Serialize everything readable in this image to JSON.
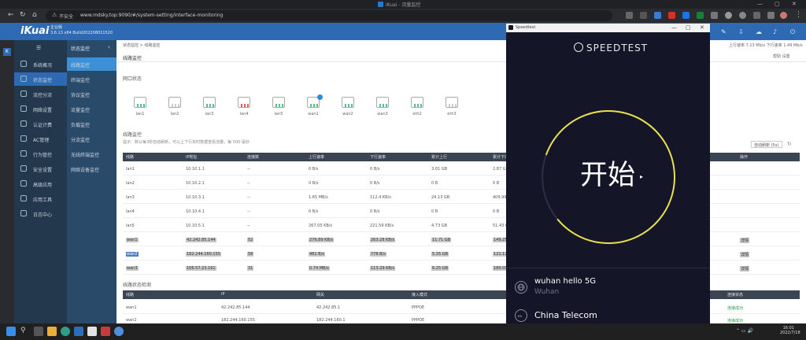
{
  "browser": {
    "title": "iKuai - 流量监控",
    "address_security": "不安全",
    "url": "www.mdsky.top:9090/#/system-setting/interface-monitoring"
  },
  "app": {
    "logo": "iKuai",
    "device_name": "企业版",
    "version": "3.6.13 x64 Build202208011520",
    "menu_label": "状态监控"
  },
  "sidebar": {
    "items": [
      {
        "label": "系统概况"
      },
      {
        "label": "状态监控"
      },
      {
        "label": "流控分流"
      },
      {
        "label": "网络设置"
      },
      {
        "label": "认证计费"
      },
      {
        "label": "AC管理"
      },
      {
        "label": "行为管控"
      },
      {
        "label": "安全设置"
      },
      {
        "label": "高级应用"
      },
      {
        "label": "应用工具"
      },
      {
        "label": "日志中心"
      }
    ]
  },
  "submenu": {
    "title": "状态监控",
    "items": [
      {
        "label": "线路监控"
      },
      {
        "label": "终端监控"
      },
      {
        "label": "协议监控"
      },
      {
        "label": "流量监控"
      },
      {
        "label": "负载监控"
      },
      {
        "label": "分流监控"
      },
      {
        "label": "无线终端监控"
      },
      {
        "label": "网络设备监控"
      }
    ]
  },
  "main": {
    "breadcrumb": "状态监控 > 线路监控",
    "page_title": "线路监控",
    "right_info_1": "上行速率 7.13 Mb/s     下行速率 1.49 Mb/s",
    "right_info_2": "帮助     设置",
    "ports_section": "网口状态",
    "ports": [
      {
        "label": "lan1",
        "state": "green"
      },
      {
        "label": "lan2",
        "state": "gray"
      },
      {
        "label": "lan3",
        "state": "green"
      },
      {
        "label": "lan4",
        "state": "red"
      },
      {
        "label": "lan5",
        "state": "green"
      },
      {
        "label": "wan1",
        "state": "green"
      },
      {
        "label": "wan2",
        "state": "green"
      },
      {
        "label": "wan3",
        "state": "green"
      },
      {
        "label": "eth2",
        "state": "green"
      },
      {
        "label": "eth3",
        "state": "gray"
      }
    ],
    "lines_section": "线路监控",
    "hint": "提示：默认每3秒自动刷新，可以上下行实时数据查看流量。每    500 毫秒",
    "filter_label": "自动刷新  (5s)",
    "columns": [
      "线路",
      "IP地址",
      "连接数",
      "上行速率",
      "下行速率",
      "累计上行",
      "累计下行",
      "操作"
    ],
    "rows": [
      {
        "name": "lan1",
        "ip": "10.10.1.1",
        "conns": "--",
        "up": "0 B/s",
        "down": "0 B/s",
        "total_up": "3.01 GB",
        "total_down": "2.87 GB",
        "op": ""
      },
      {
        "name": "lan2",
        "ip": "10.10.2.1",
        "conns": "--",
        "up": "0 B/s",
        "down": "0 B/s",
        "total_up": "0 B",
        "total_down": "0 B",
        "op": ""
      },
      {
        "name": "lan3",
        "ip": "10.10.3.1",
        "conns": "--",
        "up": "1.65 MB/s",
        "down": "112.4 KB/s",
        "total_up": "24.13 GB",
        "total_down": "409.99 GB",
        "op": ""
      },
      {
        "name": "lan4",
        "ip": "10.10.4.1",
        "conns": "--",
        "up": "0 B/s",
        "down": "0 B/s",
        "total_up": "0 B",
        "total_down": "0 B",
        "op": ""
      },
      {
        "name": "lan5",
        "ip": "10.10.5.1",
        "conns": "--",
        "up": "267.05 KB/s",
        "down": "221.59 KB/s",
        "total_up": "4.73 GB",
        "total_down": "51.43 GB",
        "op": ""
      },
      {
        "name": "wan1",
        "ip": "42.242.85.144",
        "conns": "52",
        "up": "276.89 KB/s",
        "down": "263.28 KB/s",
        "total_up": "11.71 GB",
        "total_down": "149.25 GB",
        "op": "详情"
      },
      {
        "name": "wan2",
        "ip": "182.244.160.155",
        "conns": "58",
        "up": "481 B/s",
        "down": "778 B/s",
        "total_up": "5.35 GB",
        "total_down": "121.17 GB",
        "op": "详情"
      },
      {
        "name": "wan3",
        "ip": "106.57.23.161",
        "conns": "31",
        "up": "0.74 MB/s",
        "down": "113.29 KB/s",
        "total_up": "6.25 GB",
        "total_down": "189.09 GB",
        "op": "详情"
      }
    ],
    "lines2_section": "线路状态检测",
    "columns2": [
      "线路",
      "IP",
      "网关",
      "接入模式",
      "连接状态"
    ],
    "rows2": [
      {
        "name": "wan1",
        "ip": "42.242.85.144",
        "gw": "42.242.85.1",
        "mode": "PPPOE",
        "status": "连接成功"
      },
      {
        "name": "wan2",
        "ip": "182.244.160.155",
        "gw": "182.244.160.1",
        "mode": "PPPOE",
        "status": "连接成功"
      }
    ]
  },
  "speedtest": {
    "window_title": "Speedtest",
    "brand": "SPEEDTEST",
    "go_label": "开始",
    "server_name": "wuhan hello 5G",
    "server_city": "Wuhan",
    "isp": "China Telecom",
    "accent": "#e9e04c"
  },
  "taskbar": {
    "time": "16:01",
    "date": "2022/7/18"
  }
}
